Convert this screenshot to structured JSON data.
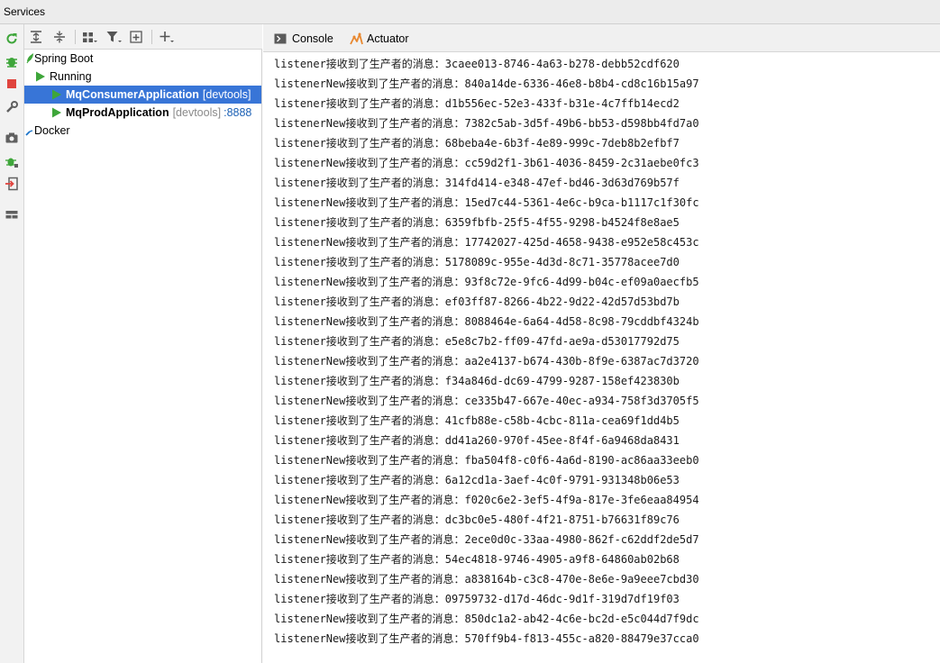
{
  "window": {
    "title": "Services"
  },
  "left_toolbar": {
    "icons": [
      "rerun-icon",
      "debug-icon",
      "stop-icon",
      "wrench-icon",
      "camera-icon",
      "debug-config-icon",
      "login-icon",
      "layout-icon"
    ]
  },
  "tree_toolbar": {
    "icons": [
      "expand-all-icon",
      "collapse-all-icon",
      "group-icon",
      "filter-icon",
      "new-service-icon",
      "add-icon"
    ]
  },
  "tree": {
    "spring_boot": "Spring Boot",
    "running": "Running",
    "consumer": {
      "name": "MqConsumerApplication",
      "tag": "[devtools]"
    },
    "producer": {
      "name": "MqProdApplication",
      "tag": "[devtools]",
      "port": ":8888"
    },
    "docker": "Docker"
  },
  "tabs": {
    "console": "Console",
    "actuator": "Actuator"
  },
  "console_lines": [
    "listener接收到了生产者的消息：3caee013-8746-4a63-b278-debb52cdf620",
    "listenerNew接收到了生产者的消息：840a14de-6336-46e8-b8b4-cd8c16b15a97",
    "listener接收到了生产者的消息：d1b556ec-52e3-433f-b31e-4c7ffb14ecd2",
    "listenerNew接收到了生产者的消息：7382c5ab-3d5f-49b6-bb53-d598bb4fd7a0",
    "listener接收到了生产者的消息：68beba4e-6b3f-4e89-999c-7deb8b2efbf7",
    "listenerNew接收到了生产者的消息：cc59d2f1-3b61-4036-8459-2c31aebe0fc3",
    "listener接收到了生产者的消息：314fd414-e348-47ef-bd46-3d63d769b57f",
    "listenerNew接收到了生产者的消息：15ed7c44-5361-4e6c-b9ca-b1117c1f30fc",
    "listener接收到了生产者的消息：6359fbfb-25f5-4f55-9298-b4524f8e8ae5",
    "listenerNew接收到了生产者的消息：17742027-425d-4658-9438-e952e58c453c",
    "listener接收到了生产者的消息：5178089c-955e-4d3d-8c71-35778acee7d0",
    "listenerNew接收到了生产者的消息：93f8c72e-9fc6-4d99-b04c-ef09a0aecfb5",
    "listener接收到了生产者的消息：ef03ff87-8266-4b22-9d22-42d57d53bd7b",
    "listenerNew接收到了生产者的消息：8088464e-6a64-4d58-8c98-79cddbf4324b",
    "listener接收到了生产者的消息：e5e8c7b2-ff09-47fd-ae9a-d53017792d75",
    "listenerNew接收到了生产者的消息：aa2e4137-b674-430b-8f9e-6387ac7d3720",
    "listener接收到了生产者的消息：f34a846d-dc69-4799-9287-158ef423830b",
    "listenerNew接收到了生产者的消息：ce335b47-667e-40ec-a934-758f3d3705f5",
    "listener接收到了生产者的消息：41cfb88e-c58b-4cbc-811a-cea69f1dd4b5",
    "listener接收到了生产者的消息：dd41a260-970f-45ee-8f4f-6a9468da8431",
    "listenerNew接收到了生产者的消息：fba504f8-c0f6-4a6d-8190-ac86aa33eeb0",
    "listener接收到了生产者的消息：6a12cd1a-3aef-4c0f-9791-931348b06e53",
    "listenerNew接收到了生产者的消息：f020c6e2-3ef5-4f9a-817e-3fe6eaa84954",
    "listener接收到了生产者的消息：dc3bc0e5-480f-4f21-8751-b76631f89c76",
    "listenerNew接收到了生产者的消息：2ece0d0c-33aa-4980-862f-c62ddf2de5d7",
    "listener接收到了生产者的消息：54ec4818-9746-4905-a9f8-64860ab02b68",
    "listenerNew接收到了生产者的消息：a838164b-c3c8-470e-8e6e-9a9eee7cbd30",
    "listener接收到了生产者的消息：09759732-d17d-46dc-9d1f-319d7df19f03",
    "listenerNew接收到了生产者的消息：850dc1a2-ab42-4c6e-bc2d-e5c044d7f9dc",
    "listenerNew接收到了生产者的消息：570ff9b4-f813-455c-a820-88479e37cca0"
  ],
  "colors": {
    "selection": "#3875d7",
    "run_green": "#3ea63a",
    "stop_red": "#e0443e",
    "actuator_orange": "#e8872e"
  }
}
